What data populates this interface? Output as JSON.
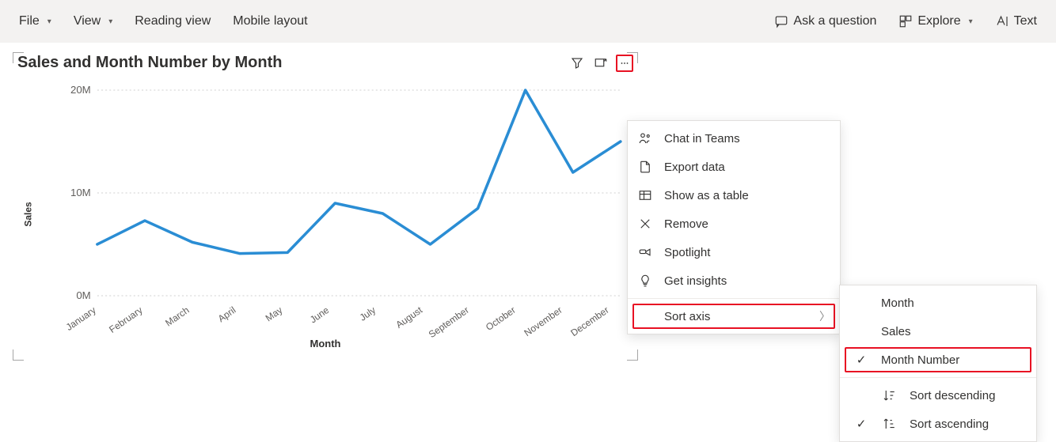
{
  "toolbar": {
    "file": "File",
    "view": "View",
    "reading_view": "Reading view",
    "mobile_layout": "Mobile layout",
    "ask": "Ask a question",
    "explore": "Explore",
    "text": "Text"
  },
  "visual": {
    "title": "Sales and Month Number by Month",
    "xlabel": "Month",
    "ylabel": "Sales"
  },
  "menu": {
    "chat": "Chat in Teams",
    "export": "Export data",
    "showtable": "Show as a table",
    "remove": "Remove",
    "spotlight": "Spotlight",
    "insights": "Get insights",
    "sortaxis": "Sort axis"
  },
  "submenu": {
    "month": "Month",
    "sales": "Sales",
    "monthnumber": "Month Number",
    "desc": "Sort descending",
    "asc": "Sort ascending"
  },
  "chart_data": {
    "type": "line",
    "title": "Sales and Month Number by Month",
    "xlabel": "Month",
    "ylabel": "Sales",
    "ylim": [
      0,
      20000000
    ],
    "yticks": [
      0,
      10000000,
      20000000
    ],
    "ytick_labels": [
      "0M",
      "10M",
      "20M"
    ],
    "categories": [
      "January",
      "February",
      "March",
      "April",
      "May",
      "June",
      "July",
      "August",
      "September",
      "October",
      "November",
      "December"
    ],
    "values": [
      5000000,
      7300000,
      5200000,
      4100000,
      4200000,
      9000000,
      8000000,
      5000000,
      8500000,
      20000000,
      12000000,
      15000000
    ]
  }
}
